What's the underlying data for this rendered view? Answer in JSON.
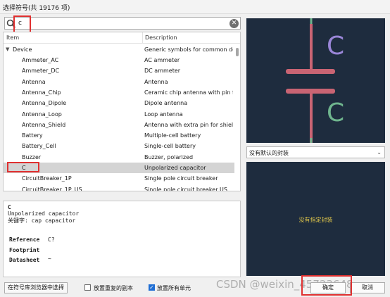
{
  "window": {
    "title": "选择符号(共 19176 项)"
  },
  "search": {
    "value": "c"
  },
  "tree": {
    "columns": [
      "Item",
      "Description"
    ],
    "group": "Device",
    "rows": [
      {
        "name": "Ammeter_AC",
        "desc": "AC ammeter"
      },
      {
        "name": "Ammeter_DC",
        "desc": "DC ammeter"
      },
      {
        "name": "Antenna",
        "desc": "Antenna"
      },
      {
        "name": "Antenna_Chip",
        "desc": "Ceramic chip antenna with pin fo"
      },
      {
        "name": "Antenna_Dipole",
        "desc": "Dipole antenna"
      },
      {
        "name": "Antenna_Loop",
        "desc": "Loop antenna"
      },
      {
        "name": "Antenna_Shield",
        "desc": "Antenna with extra pin for shield"
      },
      {
        "name": "Battery",
        "desc": "Multiple-cell battery"
      },
      {
        "name": "Battery_Cell",
        "desc": "Single-cell battery"
      },
      {
        "name": "Buzzer",
        "desc": "Buzzer, polarized"
      },
      {
        "name": "C",
        "desc": "Unpolarized capacitor"
      },
      {
        "name": "CircuitBreaker_1P",
        "desc": "Single pole circuit breaker"
      },
      {
        "name": "CircuitBreaker_1P_US",
        "desc": "Single pole circuit breaker US"
      }
    ],
    "selected": "C",
    "group_desc": "Generic symbols for common de"
  },
  "info": {
    "name": "C",
    "description": "Unpolarized capacitor",
    "keywords": "关键字: cap capacitor",
    "reference_label": "Reference",
    "reference_value": "C?",
    "footprint_label": "Footprint",
    "datasheet_label": "Datasheet",
    "datasheet_value": "~"
  },
  "preview": {
    "label_top": "C",
    "label_bottom": "C",
    "symbol_color": "#c96473",
    "text_color": "#9a86d8",
    "pin_color": "#6fb58e"
  },
  "footprint": {
    "selected": "没有默认的封装",
    "empty_text": "没有指定封装"
  },
  "buttons": {
    "browse_library": "在符号库浏览器中选择",
    "ok": "确定",
    "cancel": "取消"
  },
  "options": [
    {
      "label": "放置重复的副本",
      "checked": false
    },
    {
      "label": "放置所有单元",
      "checked": true
    }
  ],
  "watermark": "CSDN @weixin_45723648"
}
